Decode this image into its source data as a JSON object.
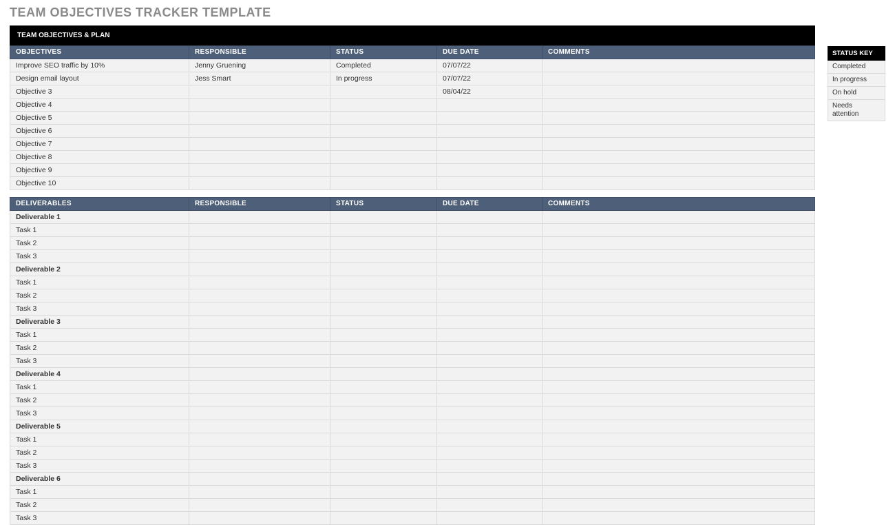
{
  "title": "TEAM OBJECTIVES TRACKER TEMPLATE",
  "section_header": "TEAM OBJECTIVES & PLAN",
  "objectives_table": {
    "headers": [
      "OBJECTIVES",
      "RESPONSIBLE",
      "STATUS",
      "DUE DATE",
      "COMMENTS"
    ],
    "rows": [
      [
        "Improve SEO traffic by 10%",
        "Jenny Gruening",
        "Completed",
        "07/07/22",
        ""
      ],
      [
        "Design email layout",
        "Jess Smart",
        "In progress",
        "07/07/22",
        ""
      ],
      [
        "Objective 3",
        "",
        "",
        "08/04/22",
        ""
      ],
      [
        "Objective 4",
        "",
        "",
        "",
        ""
      ],
      [
        "Objective 5",
        "",
        "",
        "",
        ""
      ],
      [
        "Objective 6",
        "",
        "",
        "",
        ""
      ],
      [
        "Objective 7",
        "",
        "",
        "",
        ""
      ],
      [
        "Objective 8",
        "",
        "",
        "",
        ""
      ],
      [
        "Objective 9",
        "",
        "",
        "",
        ""
      ],
      [
        "Objective 10",
        "",
        "",
        "",
        ""
      ]
    ]
  },
  "deliverables_table": {
    "headers": [
      "DELIVERABLES",
      "RESPONSIBLE",
      "STATUS",
      "DUE DATE",
      "COMMENTS"
    ],
    "rows": [
      {
        "cells": [
          "Deliverable 1",
          "",
          "",
          "",
          ""
        ],
        "bold": true
      },
      {
        "cells": [
          "Task 1",
          "",
          "",
          "",
          ""
        ],
        "bold": false
      },
      {
        "cells": [
          "Task 2",
          "",
          "",
          "",
          ""
        ],
        "bold": false
      },
      {
        "cells": [
          "Task 3",
          "",
          "",
          "",
          ""
        ],
        "bold": false
      },
      {
        "cells": [
          "Deliverable 2",
          "",
          "",
          "",
          ""
        ],
        "bold": true
      },
      {
        "cells": [
          "Task 1",
          "",
          "",
          "",
          ""
        ],
        "bold": false
      },
      {
        "cells": [
          "Task 2",
          "",
          "",
          "",
          ""
        ],
        "bold": false
      },
      {
        "cells": [
          "Task 3",
          "",
          "",
          "",
          ""
        ],
        "bold": false
      },
      {
        "cells": [
          "Deliverable 3",
          "",
          "",
          "",
          ""
        ],
        "bold": true
      },
      {
        "cells": [
          "Task 1",
          "",
          "",
          "",
          ""
        ],
        "bold": false
      },
      {
        "cells": [
          "Task 2",
          "",
          "",
          "",
          ""
        ],
        "bold": false
      },
      {
        "cells": [
          "Task 3",
          "",
          "",
          "",
          ""
        ],
        "bold": false
      },
      {
        "cells": [
          "Deliverable 4",
          "",
          "",
          "",
          ""
        ],
        "bold": true
      },
      {
        "cells": [
          "Task 1",
          "",
          "",
          "",
          ""
        ],
        "bold": false
      },
      {
        "cells": [
          "Task 2",
          "",
          "",
          "",
          ""
        ],
        "bold": false
      },
      {
        "cells": [
          "Task 3",
          "",
          "",
          "",
          ""
        ],
        "bold": false
      },
      {
        "cells": [
          "Deliverable 5",
          "",
          "",
          "",
          ""
        ],
        "bold": true
      },
      {
        "cells": [
          "Task 1",
          "",
          "",
          "",
          ""
        ],
        "bold": false
      },
      {
        "cells": [
          "Task 2",
          "",
          "",
          "",
          ""
        ],
        "bold": false
      },
      {
        "cells": [
          "Task 3",
          "",
          "",
          "",
          ""
        ],
        "bold": false
      },
      {
        "cells": [
          "Deliverable 6",
          "",
          "",
          "",
          ""
        ],
        "bold": true
      },
      {
        "cells": [
          "Task 1",
          "",
          "",
          "",
          ""
        ],
        "bold": false
      },
      {
        "cells": [
          "Task 2",
          "",
          "",
          "",
          ""
        ],
        "bold": false
      },
      {
        "cells": [
          "Task 3",
          "",
          "",
          "",
          ""
        ],
        "bold": false
      }
    ]
  },
  "status_key": {
    "header": "STATUS KEY",
    "items": [
      "Completed",
      "In progress",
      "On hold",
      "Needs attention"
    ]
  }
}
